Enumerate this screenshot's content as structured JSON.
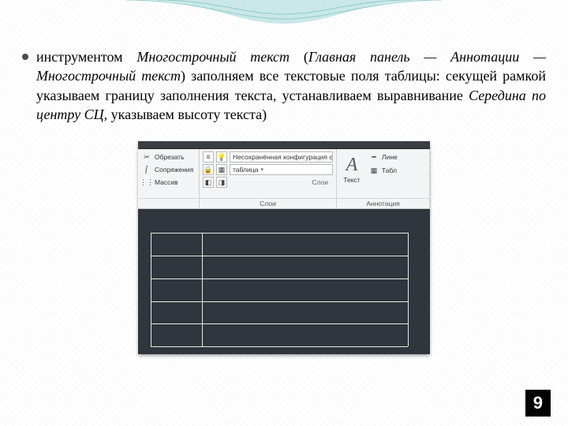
{
  "slide": {
    "bullet": {
      "pre": "инструментом",
      "it1": " Многострочный текст ",
      "paren_open": "(",
      "it2": "Главная панель — Аннотации — Многострочный текст",
      "paren_close": ") ",
      "mid": "заполняем все текстовые поля таблицы: секущей рамкой указываем границу заполнения текста, устанавливаем выравнивание",
      "it3": " Середина по центру СЦ",
      "tail": ", указываем высоту текста)"
    },
    "page_number": "9"
  },
  "ribbon": {
    "left": {
      "row1_label": "Обрезать",
      "row2_label": "Сопряжения",
      "row3_label": "Массив"
    },
    "mid": {
      "combo1": "Несохранённая конфигурация сло",
      "combo2": "таблица",
      "layers_label": "Слои"
    },
    "right": {
      "bigA_label": "Текст",
      "item1": "Лине",
      "item2": "Табл",
      "footer": "Аннотация"
    },
    "footers": {
      "left": "",
      "mid": "Слои",
      "right": "Аннотация"
    }
  },
  "icons": {
    "trim": "✂",
    "fillet": "⎛",
    "array": "⋮⋮",
    "layer_bulb": "💡",
    "layer_lock": "🔒",
    "table": "▦",
    "dim": "━",
    "caret": "▾"
  }
}
